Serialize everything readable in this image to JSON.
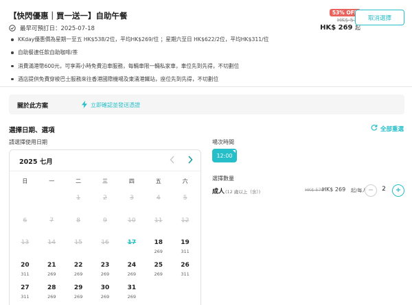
{
  "header": {
    "title": "【快閃優惠｜買一送一】自助午餐",
    "earliest_date": "最早可預訂日：2025-07-18",
    "discount_badge": "53% OFF",
    "original_price": "HK$ 570",
    "current_price": "HK$ 269",
    "price_suffix": "起",
    "cancel_label": "取消選擇"
  },
  "highlights": [
    "KKday優惠價為星期一至五 HK$538/2位，平均HK$269/位 ；星期六至日 HK$622/2位，平均HK$311/位",
    "自助餐連任飲自助咖啡/茶",
    "消費滿港幣600元，可享兩小時免費泊車服務，每輛車限一輛私家車，車位先到先得，不切劃位",
    "酒店提供免費穿梭巴士服務來往香港國際機場及東涌港鐵站，座位先到先得，不切劃位"
  ],
  "about": {
    "label": "關於此方案",
    "instant_confirm": "立即確認並發送憑證"
  },
  "selection": {
    "title": "選擇日期、選項",
    "reset_label": "全部重選",
    "date_label": "請選擇使用日期"
  },
  "calendar": {
    "month_label": "2025 七月",
    "weekdays": [
      "日",
      "一",
      "二",
      "三",
      "四",
      "五",
      "六"
    ],
    "days": [
      {
        "num": "",
        "price": "",
        "state": "empty"
      },
      {
        "num": "",
        "price": "",
        "state": "empty"
      },
      {
        "num": "1",
        "price": "",
        "state": "disabled"
      },
      {
        "num": "2",
        "price": "",
        "state": "disabled"
      },
      {
        "num": "3",
        "price": "",
        "state": "disabled"
      },
      {
        "num": "4",
        "price": "",
        "state": "disabled"
      },
      {
        "num": "5",
        "price": "",
        "state": "disabled"
      },
      {
        "num": "6",
        "price": "",
        "state": "disabled"
      },
      {
        "num": "7",
        "price": "",
        "state": "disabled"
      },
      {
        "num": "8",
        "price": "",
        "state": "disabled"
      },
      {
        "num": "9",
        "price": "",
        "state": "disabled"
      },
      {
        "num": "10",
        "price": "",
        "state": "disabled"
      },
      {
        "num": "11",
        "price": "",
        "state": "disabled"
      },
      {
        "num": "12",
        "price": "",
        "state": "disabled"
      },
      {
        "num": "13",
        "price": "",
        "state": "disabled"
      },
      {
        "num": "14",
        "price": "",
        "state": "disabled"
      },
      {
        "num": "15",
        "price": "",
        "state": "disabled"
      },
      {
        "num": "16",
        "price": "",
        "state": "disabled"
      },
      {
        "num": "17",
        "price": "",
        "state": "today"
      },
      {
        "num": "18",
        "price": "269",
        "state": "available"
      },
      {
        "num": "19",
        "price": "311",
        "state": "available"
      },
      {
        "num": "20",
        "price": "311",
        "state": "available"
      },
      {
        "num": "21",
        "price": "269",
        "state": "available"
      },
      {
        "num": "22",
        "price": "269",
        "state": "available"
      },
      {
        "num": "23",
        "price": "269",
        "state": "available"
      },
      {
        "num": "24",
        "price": "269",
        "state": "available"
      },
      {
        "num": "25",
        "price": "269",
        "state": "available"
      },
      {
        "num": "26",
        "price": "311",
        "state": "available"
      },
      {
        "num": "27",
        "price": "311",
        "state": "available"
      },
      {
        "num": "28",
        "price": "269",
        "state": "available"
      },
      {
        "num": "29",
        "price": "269",
        "state": "available"
      },
      {
        "num": "30",
        "price": "269",
        "state": "available"
      },
      {
        "num": "31",
        "price": "269",
        "state": "available"
      }
    ]
  },
  "session": {
    "label": "場次時間",
    "time": "12:00"
  },
  "quantity": {
    "label": "選擇數量",
    "adult": "成人",
    "adult_age": "(12 歲以上（含）)",
    "original_price": "HK$ 570",
    "price": "HK$ 269",
    "unit": "起/每人",
    "value": "2"
  },
  "colors": {
    "accent": "#26bec9",
    "badge": "#e9635d"
  }
}
